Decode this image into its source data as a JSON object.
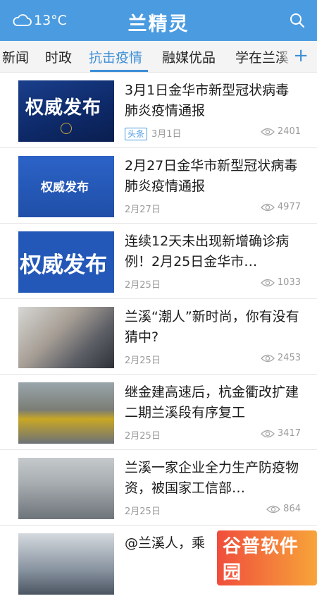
{
  "header": {
    "weather_icon": "cloud-icon",
    "temperature": "13°C",
    "title": "兰精灵",
    "search_icon": "search-icon",
    "color": "#4a9be0"
  },
  "tabs": {
    "items": [
      "新闻",
      "时政",
      "抗击疫情",
      "融媒优品",
      "学在兰溪"
    ],
    "active": "抗击疫情",
    "add_label": "+"
  },
  "feed": [
    {
      "title": "3月1日金华市新型冠状病毒肺炎疫情通报",
      "tag": "头条",
      "date": "3月1日",
      "views": "2401",
      "thumb_text": "权威发布"
    },
    {
      "title": "2月27日金华市新型冠状病毒肺炎疫情通报",
      "tag": "",
      "date": "2月27日",
      "views": "4977",
      "thumb_text": "权威发布"
    },
    {
      "title": "连续12天未出现新增确诊病例！2月25日金华市…",
      "tag": "",
      "date": "2月25日",
      "views": "1033",
      "thumb_text": "权威发布"
    },
    {
      "title": "兰溪“潮人”新时尚，你有没有猜中?",
      "tag": "",
      "date": "2月25日",
      "views": "2453",
      "thumb_text": ""
    },
    {
      "title": "继金建高速后，杭金衢改扩建二期兰溪段有序复工",
      "tag": "",
      "date": "2月25日",
      "views": "3417",
      "thumb_text": ""
    },
    {
      "title": "兰溪一家企业全力生产防疫物资，被国家工信部…",
      "tag": "",
      "date": "2月25日",
      "views": "864",
      "thumb_text": ""
    },
    {
      "title": "@兰溪人，乘",
      "tag": "",
      "date": "",
      "views": "",
      "thumb_text": ""
    }
  ],
  "watermark": "谷普软件园",
  "colors": {
    "accent": "#3d8fd6",
    "tag": "#4a9be0"
  }
}
